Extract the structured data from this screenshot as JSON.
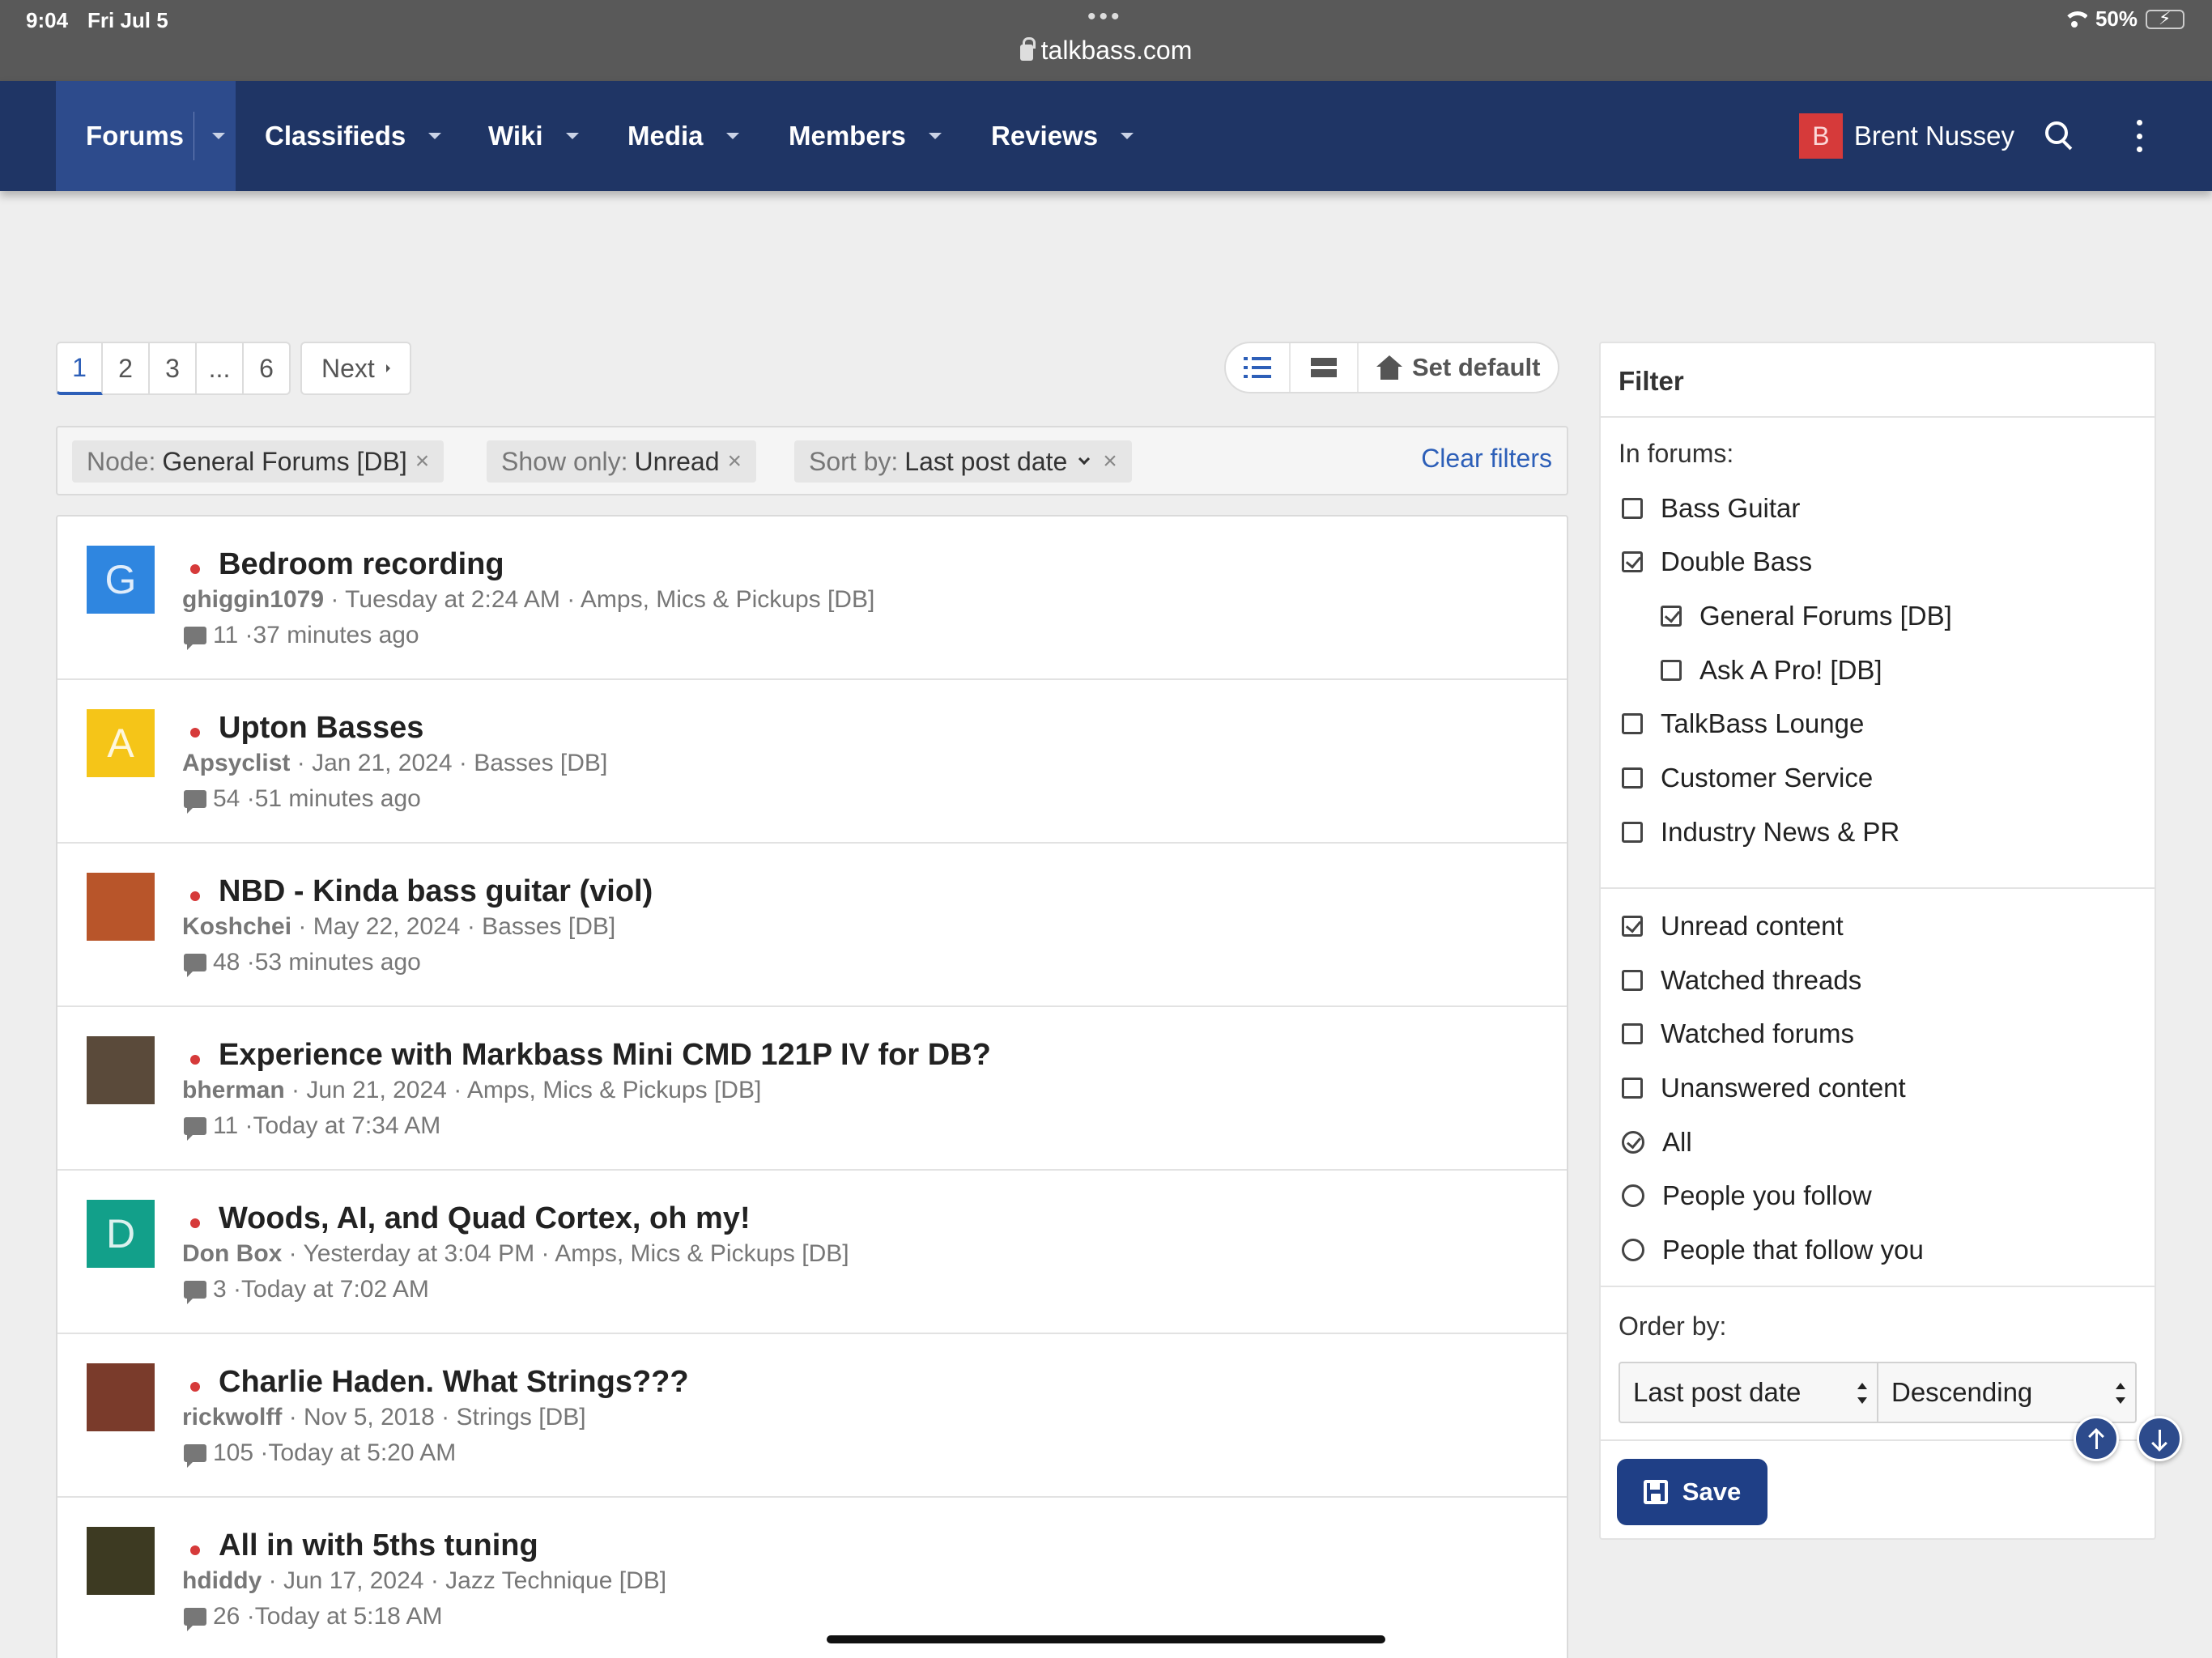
{
  "status_bar": {
    "time": "9:04",
    "date": "Fri Jul 5",
    "url": "talkbass.com",
    "battery": "50%",
    "battery_level": 0.5
  },
  "nav": {
    "tabs": [
      {
        "label": "Forums"
      },
      {
        "label": "Classifieds"
      },
      {
        "label": "Wiki"
      },
      {
        "label": "Media"
      },
      {
        "label": "Members"
      },
      {
        "label": "Reviews"
      }
    ],
    "user": {
      "initial": "B",
      "name": "Brent Nussey"
    }
  },
  "pagination": {
    "pages": [
      "1",
      "2",
      "3",
      "...",
      "6"
    ],
    "next": "Next"
  },
  "view": {
    "set_default": "Set default"
  },
  "filters": {
    "chips": [
      {
        "key": "Node:",
        "value": "General Forums [DB]"
      },
      {
        "key": "Show only:",
        "value": "Unread"
      },
      {
        "key": "Sort by:",
        "value": "Last post date"
      }
    ],
    "clear": "Clear filters"
  },
  "threads": [
    {
      "avatar_letter": "G",
      "avatar_color": "#2f86e0",
      "title": "Bedroom recording",
      "author": "ghiggin1079",
      "date": "Tuesday at 2:24 AM",
      "forum": "Amps, Mics & Pickups [DB]",
      "replies": "11",
      "last": "37 minutes ago"
    },
    {
      "avatar_letter": "A",
      "avatar_color": "#f5c518",
      "title": "Upton Basses",
      "author": "Apsyclist",
      "date": "Jan 21, 2024",
      "forum": "Basses [DB]",
      "replies": "54",
      "last": "51 minutes ago"
    },
    {
      "avatar_letter": "",
      "avatar_color": "#b8552a",
      "title": "NBD - Kinda bass guitar (viol)",
      "author": "Koshchei",
      "date": "May 22, 2024",
      "forum": "Basses [DB]",
      "replies": "48",
      "last": "53 minutes ago"
    },
    {
      "avatar_letter": "",
      "avatar_color": "#5a4a3a",
      "title": "Experience with Markbass Mini CMD 121P IV for DB?",
      "author": "bherman",
      "date": "Jun 21, 2024",
      "forum": "Amps, Mics & Pickups [DB]",
      "replies": "11",
      "last": "Today at 7:34 AM"
    },
    {
      "avatar_letter": "D",
      "avatar_color": "#12a08a",
      "title": "Woods, AI, and Quad Cortex, oh my!",
      "author": "Don Box",
      "date": "Yesterday at 3:04 PM",
      "forum": "Amps, Mics & Pickups [DB]",
      "replies": "3",
      "last": "Today at 7:02 AM"
    },
    {
      "avatar_letter": "",
      "avatar_color": "#7a3b2b",
      "title": "Charlie Haden. What Strings???",
      "author": "rickwolff",
      "date": "Nov 5, 2018",
      "forum": "Strings [DB]",
      "replies": "105",
      "last": "Today at 5:20 AM"
    },
    {
      "avatar_letter": "",
      "avatar_color": "#3d3a22",
      "title": "All in with 5ths tuning",
      "author": "hdiddy",
      "date": "Jun 17, 2024",
      "forum": "Jazz Technique [DB]",
      "replies": "26",
      "last": "Today at 5:18 AM"
    }
  ],
  "panel": {
    "title": "Filter",
    "in_forums_label": "In forums:",
    "forums": [
      {
        "label": "Bass Guitar",
        "checked": false,
        "indent": false
      },
      {
        "label": "Double Bass",
        "checked": true,
        "indent": false
      },
      {
        "label": "General Forums [DB]",
        "checked": true,
        "indent": true
      },
      {
        "label": "Ask A Pro! [DB]",
        "checked": false,
        "indent": true
      },
      {
        "label": "TalkBass Lounge",
        "checked": false,
        "indent": false
      },
      {
        "label": "Customer Service",
        "checked": false,
        "indent": false
      },
      {
        "label": "Industry News & PR",
        "checked": false,
        "indent": false
      }
    ],
    "show_options": [
      {
        "label": "Unread content",
        "checked": true
      },
      {
        "label": "Watched threads",
        "checked": false
      },
      {
        "label": "Watched forums",
        "checked": false
      },
      {
        "label": "Unanswered content",
        "checked": false
      }
    ],
    "people_options": [
      {
        "label": "All",
        "checked": true
      },
      {
        "label": "People you follow",
        "checked": false
      },
      {
        "label": "People that follow you",
        "checked": false
      }
    ],
    "order_label": "Order by:",
    "order_field": "Last post date",
    "order_dir": "Descending",
    "save": "Save"
  },
  "colors": {
    "nav_bg": "#1f3565",
    "accent": "#2d5fb8",
    "unread_dot": "#d63a3a",
    "save_bg": "#1f3f86"
  }
}
